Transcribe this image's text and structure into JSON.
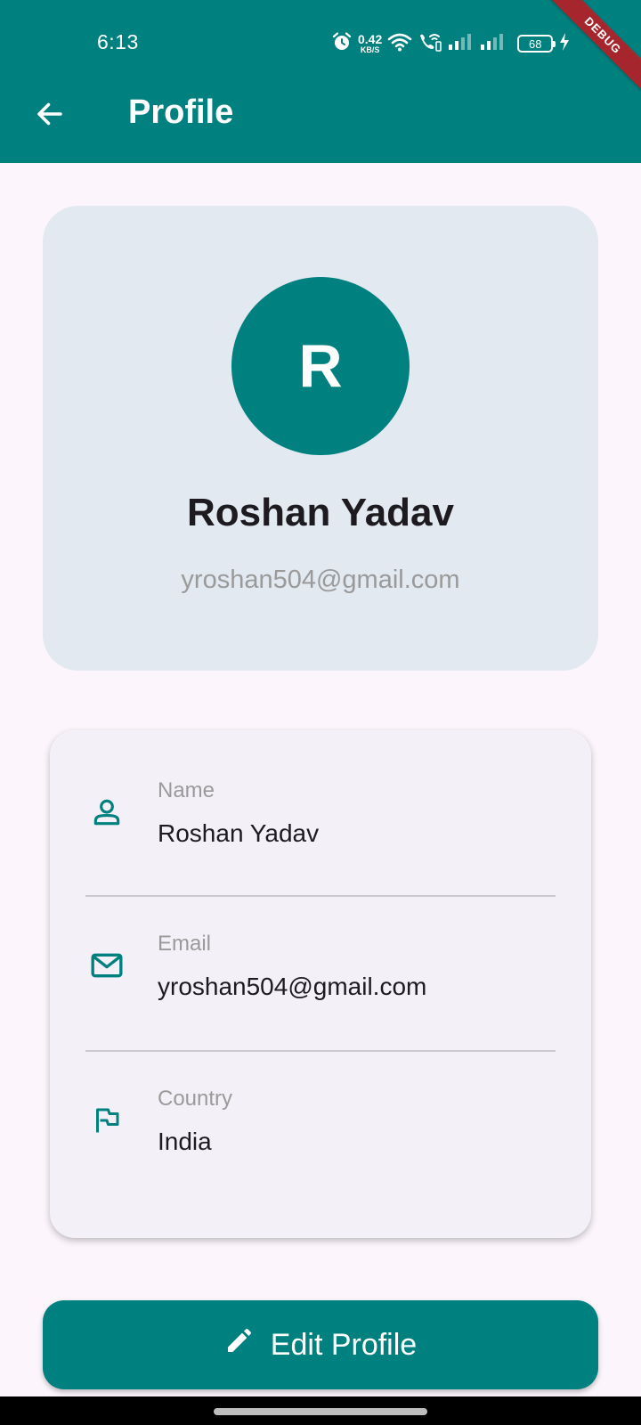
{
  "status_bar": {
    "time": "6:13",
    "net_speed_value": "0.42",
    "net_speed_unit": "KB/S",
    "battery": "68"
  },
  "debug_banner": "DEBUG",
  "app_bar": {
    "title": "Profile"
  },
  "profile_header": {
    "avatar_initial": "R",
    "name": "Roshan Yadav",
    "email": "yroshan504@gmail.com"
  },
  "info_card": {
    "rows": [
      {
        "label": "Name",
        "value": "Roshan Yadav",
        "icon": "person-icon"
      },
      {
        "label": "Email",
        "value": "yroshan504@gmail.com",
        "icon": "mail-icon"
      },
      {
        "label": "Country",
        "value": "India",
        "icon": "flag-icon"
      }
    ]
  },
  "edit_button": {
    "label": "Edit Profile",
    "icon": "pencil-icon"
  },
  "colors": {
    "primary": "#00807F",
    "background": "#FCF6FC",
    "header_card": "#E2E9F1",
    "info_card": "#F4F0F7",
    "secondary_text": "#9A9A9A",
    "debug": "#A6262D"
  }
}
